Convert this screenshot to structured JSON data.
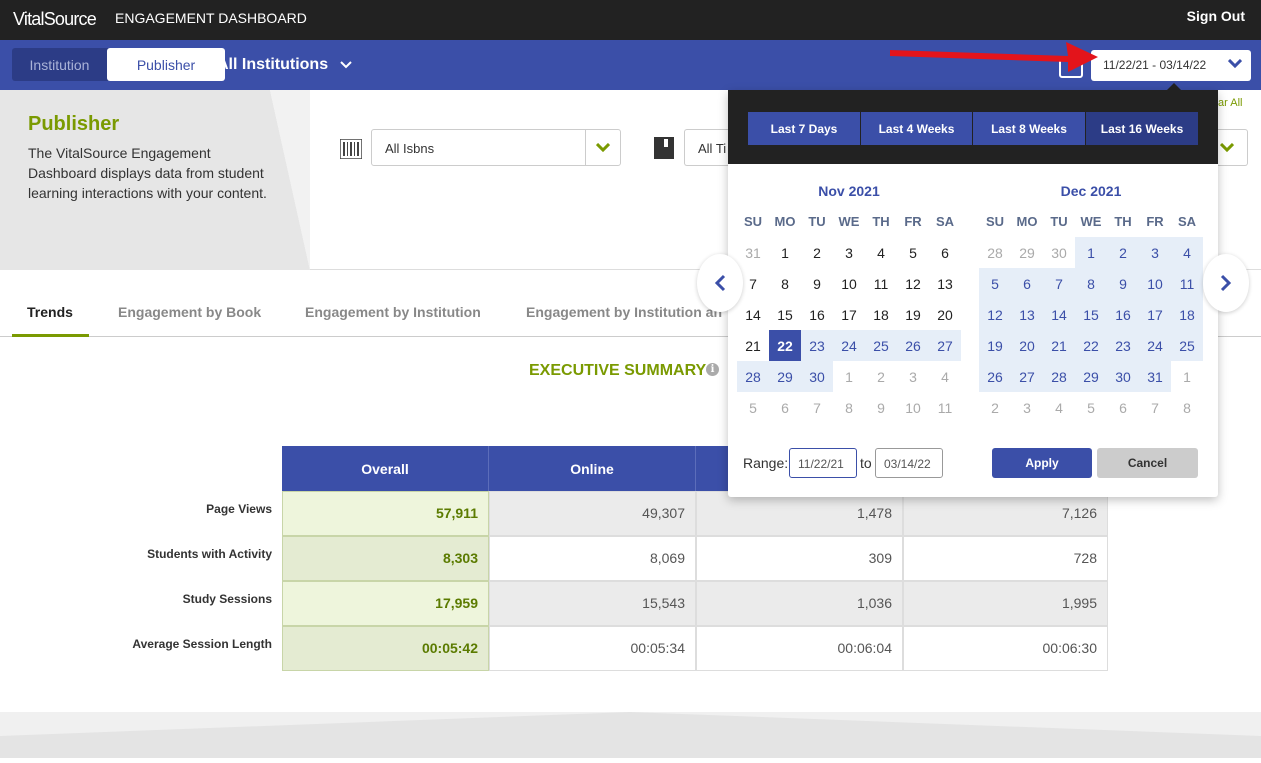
{
  "topbar": {
    "brand": "VitalSource",
    "brand_sub": "ENGAGEMENT DASHBOARD",
    "sign_out": "Sign Out"
  },
  "nav": {
    "institution_label": "Institution",
    "publisher_label": "Publisher",
    "institution_select": "All Institutions",
    "date_range": "11/22/21 - 03/14/22"
  },
  "publisher": {
    "title": "Publisher",
    "description": "The VitalSource Engagement Dashboard displays data from student learning interactions with your content.",
    "isbn_filter": "All Isbns",
    "title_filter": "All Ti",
    "clear_all": "ar All"
  },
  "tabs": [
    "Trends",
    "Engagement by Book",
    "Engagement by Institution",
    "Engagement by Institution an"
  ],
  "summary": {
    "heading": "EXECUTIVE SUMMARY",
    "info_icon": "i",
    "columns": [
      "Overall",
      "Online",
      "",
      ""
    ],
    "rows": [
      {
        "label": "Page Views",
        "values": [
          "57,911",
          "49,307",
          "1,478",
          "7,126"
        ]
      },
      {
        "label": "Students with Activity",
        "values": [
          "8,303",
          "8,069",
          "309",
          "728"
        ]
      },
      {
        "label": "Study Sessions",
        "values": [
          "17,959",
          "15,543",
          "1,036",
          "1,995"
        ]
      },
      {
        "label": "Average Session Length",
        "values": [
          "00:05:42",
          "00:05:34",
          "00:06:04",
          "00:06:30"
        ]
      }
    ]
  },
  "datepicker": {
    "presets": [
      "Last 7 Days",
      "Last 4 Weeks",
      "Last 8 Weeks",
      "Last 16 Weeks"
    ],
    "selected_preset": 3,
    "dow": [
      "SU",
      "MO",
      "TU",
      "WE",
      "TH",
      "FR",
      "SA"
    ],
    "months": [
      {
        "title": "Nov 2021",
        "weeks": [
          [
            "31",
            "1",
            "2",
            "3",
            "4",
            "5",
            "6"
          ],
          [
            "7",
            "8",
            "9",
            "10",
            "11",
            "12",
            "13"
          ],
          [
            "14",
            "15",
            "16",
            "17",
            "18",
            "19",
            "20"
          ],
          [
            "21",
            "22",
            "23",
            "24",
            "25",
            "26",
            "27"
          ],
          [
            "28",
            "29",
            "30",
            "1",
            "2",
            "3",
            "4"
          ],
          [
            "5",
            "6",
            "7",
            "8",
            "9",
            "10",
            "11"
          ]
        ]
      },
      {
        "title": "Dec 2021",
        "weeks": [
          [
            "28",
            "29",
            "30",
            "1",
            "2",
            "3",
            "4"
          ],
          [
            "5",
            "6",
            "7",
            "8",
            "9",
            "10",
            "11"
          ],
          [
            "12",
            "13",
            "14",
            "15",
            "16",
            "17",
            "18"
          ],
          [
            "19",
            "20",
            "21",
            "22",
            "23",
            "24",
            "25"
          ],
          [
            "26",
            "27",
            "28",
            "29",
            "30",
            "31",
            "1"
          ],
          [
            "2",
            "3",
            "4",
            "5",
            "6",
            "7",
            "8"
          ]
        ]
      }
    ],
    "range_label": "Range:",
    "range_start": "11/22/21",
    "range_to": "to",
    "range_end": "03/14/22",
    "apply": "Apply",
    "cancel": "Cancel"
  },
  "colors": {
    "primary": "#3b4fa8",
    "accent_green": "#7a9a01",
    "dark": "#222222",
    "annotation_arrow": "#e3141b"
  }
}
